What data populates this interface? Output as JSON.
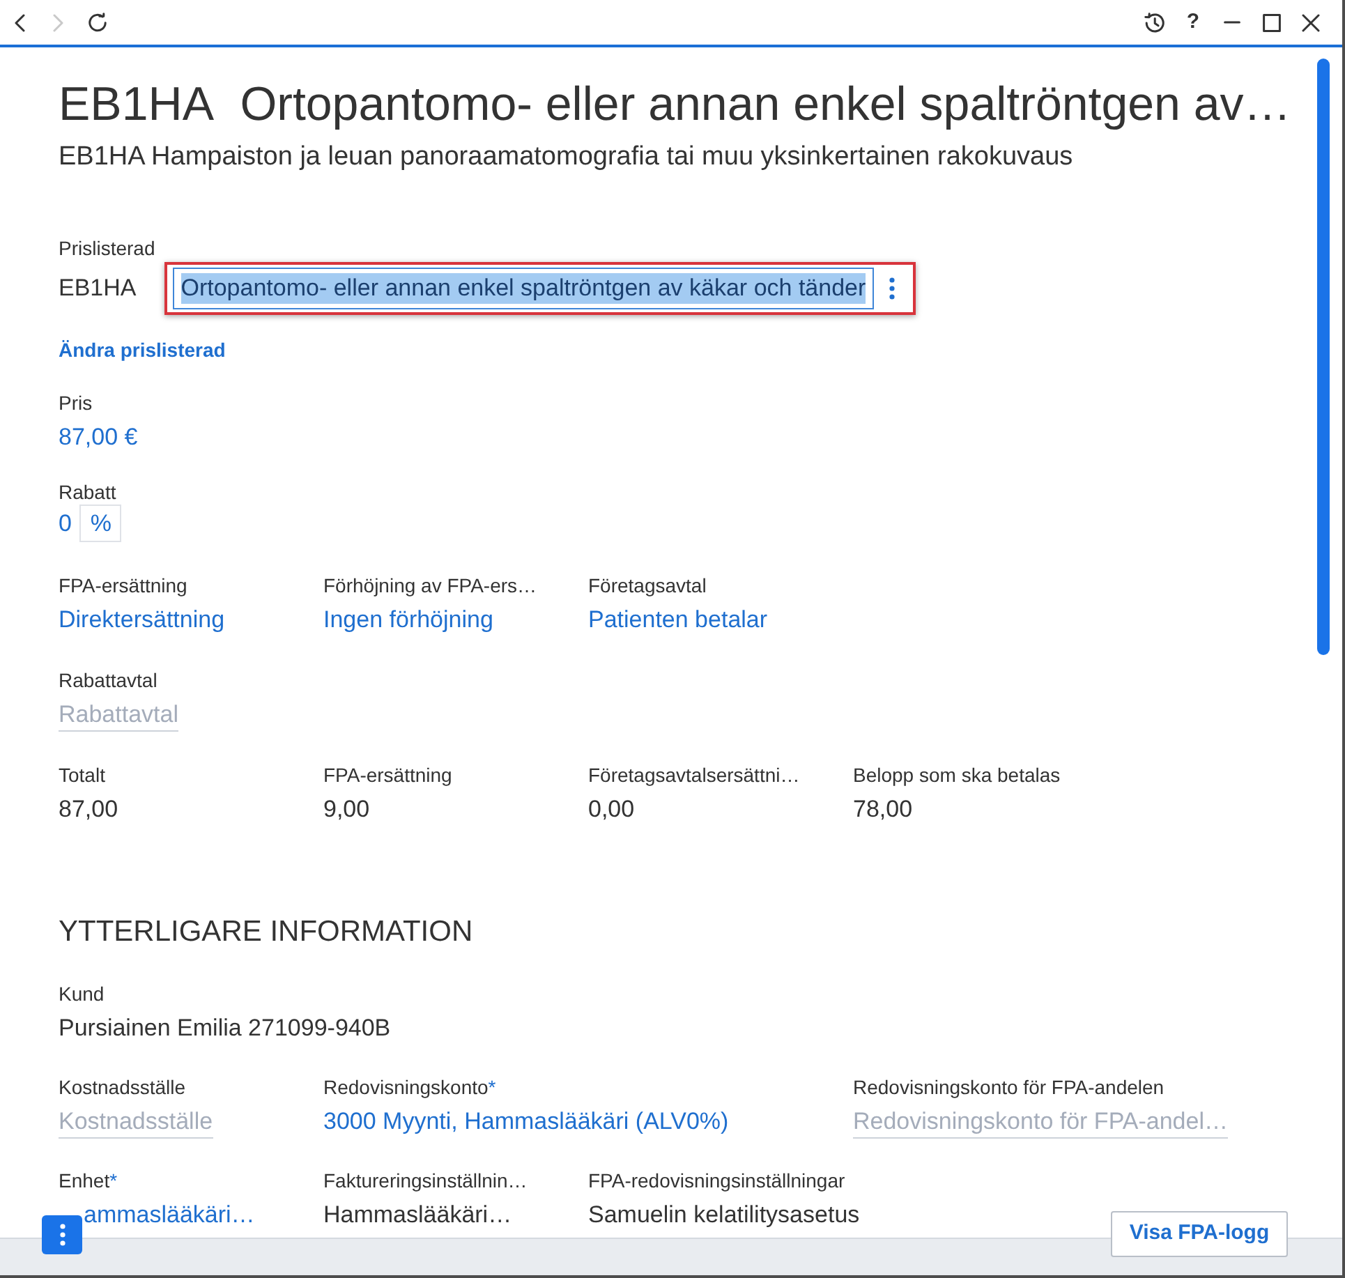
{
  "title_bar": {
    "nav_buttons": [
      {
        "kind": "back",
        "disabled": false
      },
      {
        "kind": "forward",
        "disabled": true
      },
      {
        "kind": "refresh",
        "disabled": false
      }
    ],
    "window_buttons": [
      {
        "kind": "history"
      },
      {
        "kind": "help",
        "label": "?"
      },
      {
        "kind": "minimize"
      },
      {
        "kind": "maximize"
      },
      {
        "kind": "close"
      }
    ]
  },
  "header": {
    "code": "EB1HA",
    "title": "Ortopantomo- eller annan enkel spaltröntgen av…",
    "subtitle": "EB1HA Hampaiston ja leuan panoraamatomografia tai muu yksinkertainen rakokuvaus"
  },
  "price_list_row": {
    "label": "Prislisterad",
    "code": "EB1HA",
    "value": "Ortopantomo- eller annan enkel spaltröntgen av käkar och tänder",
    "text_selected": true,
    "highlighted": true,
    "change_link": "Ändra prislisterad"
  },
  "price": {
    "label": "Pris",
    "value": "87,00 €"
  },
  "discount": {
    "label": "Rabatt",
    "value": "0",
    "unit": "%"
  },
  "field_rows": [
    [
      {
        "kind": "link",
        "label": "FPA-ersättning",
        "value": "Direktersättning"
      },
      {
        "kind": "link",
        "label": "Förhöjning av FPA-ers…",
        "value": "Ingen förhöjning"
      },
      {
        "kind": "link",
        "label": "Företagsavtal",
        "value": "Patienten betalar"
      }
    ],
    [
      {
        "kind": "empty",
        "label": "Rabattavtal",
        "placeholder": "Rabattavtal"
      }
    ],
    [
      {
        "kind": "text",
        "label": "Totalt",
        "value": "87,00"
      },
      {
        "kind": "text",
        "label": "FPA-ersättning",
        "value": "9,00"
      },
      {
        "kind": "text",
        "label": "Företagsavtalsersättni…",
        "value": "0,00"
      },
      {
        "kind": "text",
        "label": "Belopp som ska betalas",
        "value": "78,00"
      }
    ]
  ],
  "additional_info": {
    "title": "YTTERLIGARE INFORMATION",
    "field_rows": [
      [
        {
          "kind": "text",
          "label": "Kund",
          "value": "Pursiainen Emilia 271099-940B"
        }
      ],
      [
        {
          "kind": "empty",
          "label": "Kostnadsställe",
          "placeholder": "Kostnadsställe"
        },
        {
          "kind": "link",
          "label": "Redovisningskonto",
          "required_mark": "*",
          "value": "3000 Myynti, Hammaslääkäri (ALV0%)"
        },
        {
          "kind": "empty",
          "label": "Redovisningskonto för FPA-andelen",
          "placeholder": "Redovisningskonto för FPA-andel…"
        }
      ],
      [
        {
          "kind": "link",
          "label": "Enhet",
          "required_mark": "*",
          "value": "ammaslääkäri…"
        },
        {
          "kind": "text",
          "label": "Faktureringsinställnin…",
          "value": "Hammaslääkäri…"
        },
        {
          "kind": "text",
          "label": "FPA-redovisningsinställningar",
          "value": "Samuelin kelatilitysasetus"
        }
      ]
    ]
  },
  "footer": {
    "menu_button": {
      "kind": "more"
    },
    "button": "Visa FPA-logg"
  }
}
